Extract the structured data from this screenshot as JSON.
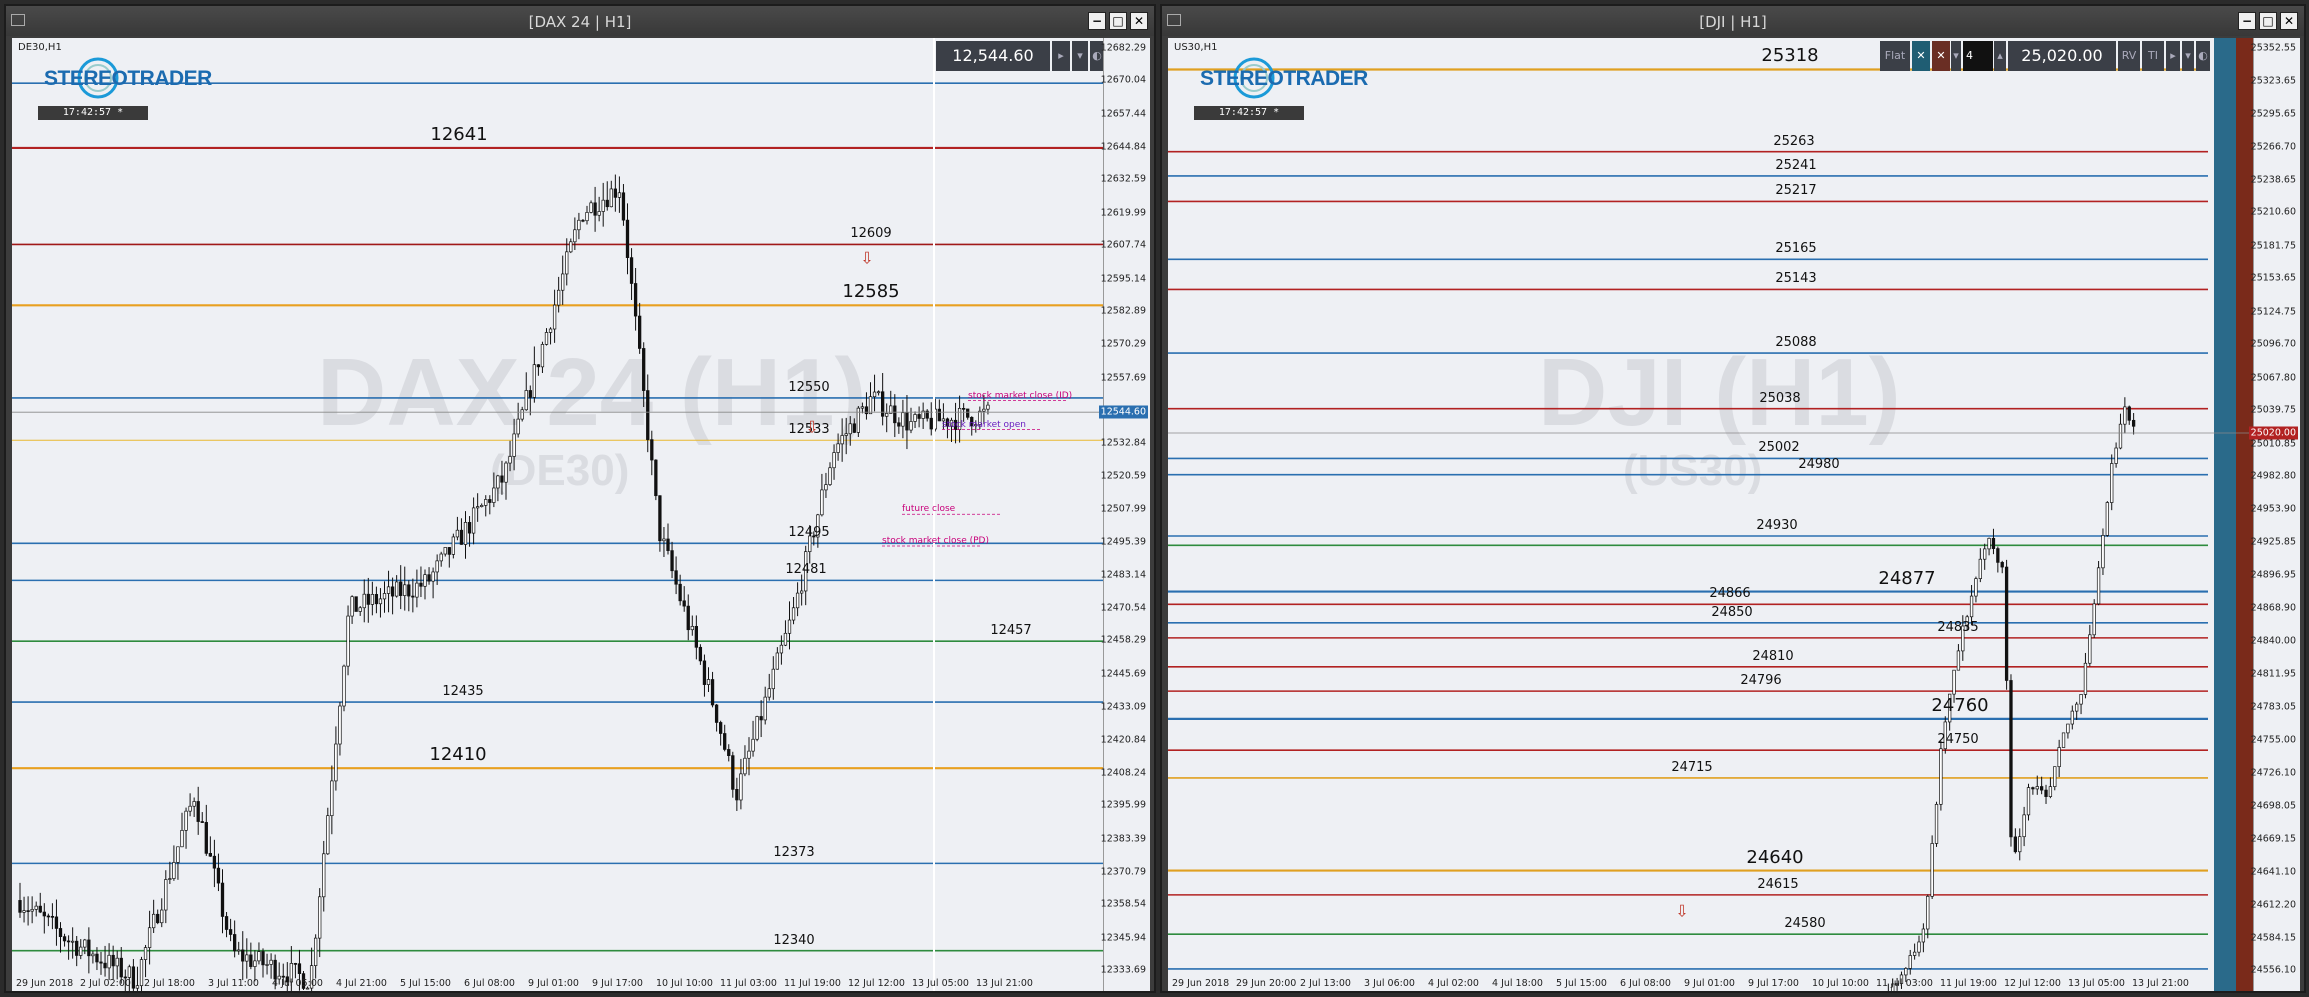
{
  "left": {
    "title": "[DAX 24 | H1]",
    "symbol": "DE30,H1",
    "logo": "STEREOTRADER",
    "clock": "17:42:57 *",
    "price_box": "12,544.60",
    "watermark_main": "DAX 24 (H1)",
    "watermark_sub": "(DE30)",
    "current_price": "12544.60",
    "y_ticks": [
      "12682.29",
      "12670.04",
      "12657.44",
      "12644.84",
      "12632.59",
      "12619.99",
      "12607.74",
      "12595.14",
      "12582.89",
      "12570.29",
      "12557.69",
      "12545.44",
      "12532.84",
      "12520.59",
      "12507.99",
      "12495.39",
      "12483.14",
      "12470.54",
      "12458.29",
      "12445.69",
      "12433.09",
      "12420.84",
      "12408.24",
      "12395.99",
      "12383.39",
      "12370.79",
      "12358.54",
      "12345.94",
      "12333.69"
    ],
    "x_ticks": [
      "29 Jun 2018",
      "2 Jul 02:00",
      "2 Jul 18:00",
      "3 Jul 11:00",
      "4 Jul 05:00",
      "4 Jul 21:00",
      "5 Jul 15:00",
      "6 Jul 08:00",
      "9 Jul 01:00",
      "9 Jul 17:00",
      "10 Jul 10:00",
      "11 Jul 03:00",
      "11 Jul 19:00",
      "12 Jul 12:00",
      "13 Jul 05:00",
      "13 Jul 21:00"
    ],
    "levels": [
      {
        "label": "12641",
        "price": 12644.5,
        "color": "#b22222",
        "big": true
      },
      {
        "label": "12609",
        "price": 12608,
        "color": "#a01818",
        "big": false
      },
      {
        "label": "12585",
        "price": 12585,
        "color": "#e8a020",
        "big": true
      },
      {
        "label": "12550",
        "price": 12550,
        "color": "#2a6fb0",
        "big": false
      },
      {
        "label": "12533",
        "price": 12534,
        "color": "#e8b830",
        "big": false
      },
      {
        "label": "12495",
        "price": 12495,
        "color": "#2a6fb0",
        "big": false
      },
      {
        "label": "12481",
        "price": 12481,
        "color": "#2a6fb0",
        "big": false
      },
      {
        "label": "12457",
        "price": 12458,
        "color": "#2e8b3e",
        "big": false
      },
      {
        "label": "12435",
        "price": 12435,
        "color": "#2a6fb0",
        "big": false
      },
      {
        "label": "12410",
        "price": 12410,
        "color": "#e8a020",
        "big": true
      },
      {
        "label": "12373",
        "price": 12374,
        "color": "#2a6fb0",
        "big": false
      },
      {
        "label": "12340",
        "price": 12341,
        "color": "#2e8b3e",
        "big": false
      },
      {
        "label": "",
        "price": 12669,
        "color": "#2a6fb0",
        "big": false
      }
    ],
    "annotations": [
      "stock market close (ID)",
      "stock market open",
      "future close",
      "stock market close (PD)"
    ]
  },
  "right": {
    "title": "[DJI | H1]",
    "symbol": "US30,H1",
    "logo": "STEREOTRADER",
    "clock": "17:42:57 *",
    "price_box": "25,020.00",
    "toolbar": {
      "flat": "Flat",
      "lots": "4",
      "rv": "RV",
      "tl": "TI"
    },
    "watermark_main": "DJI (H1)",
    "watermark_sub": "(US30)",
    "current_price": "25020.00",
    "y_ticks": [
      "25352.55",
      "25323.65",
      "25295.65",
      "25266.70",
      "25238.65",
      "25210.60",
      "25181.75",
      "25153.65",
      "25124.75",
      "25096.70",
      "25067.80",
      "25039.75",
      "25010.85",
      "24982.80",
      "24953.90",
      "24925.85",
      "24896.95",
      "24868.90",
      "24840.00",
      "24811.95",
      "24783.05",
      "24755.00",
      "24726.10",
      "24698.05",
      "24669.15",
      "24641.10",
      "24612.20",
      "24584.15",
      "24556.10"
    ],
    "x_ticks": [
      "29 Jun 2018",
      "29 Jun 20:00",
      "2 Jul 13:00",
      "3 Jul 06:00",
      "4 Jul 02:00",
      "4 Jul 18:00",
      "5 Jul 15:00",
      "6 Jul 08:00",
      "9 Jul 01:00",
      "9 Jul 17:00",
      "10 Jul 10:00",
      "11 Jul 03:00",
      "11 Jul 19:00",
      "12 Jul 12:00",
      "13 Jul 05:00",
      "13 Jul 21:00"
    ],
    "levels": [
      {
        "label": "25318",
        "price": 25334,
        "color": "#e0a020",
        "big": true
      },
      {
        "label": "25263",
        "price": 25263,
        "color": "#b22222",
        "big": false
      },
      {
        "label": "25241",
        "price": 25242,
        "color": "#2a6fb0",
        "big": false
      },
      {
        "label": "25217",
        "price": 25220,
        "color": "#b22222",
        "big": false
      },
      {
        "label": "25165",
        "price": 25170,
        "color": "#2a6fb0",
        "big": false
      },
      {
        "label": "25143",
        "price": 25144,
        "color": "#b22222",
        "big": false
      },
      {
        "label": "25088",
        "price": 25089,
        "color": "#2a6fb0",
        "big": false
      },
      {
        "label": "25038",
        "price": 25041,
        "color": "#b22222",
        "big": false
      },
      {
        "label": "25002",
        "price": 24998,
        "color": "#2a6fb0",
        "big": false
      },
      {
        "label": "24980",
        "price": 24984,
        "color": "#2a6fb0",
        "big": false
      },
      {
        "label": "24930",
        "price": 24931,
        "color": "#2a6fb0",
        "big": false
      },
      {
        "label": "",
        "price": 24923,
        "color": "#2e8b3e",
        "big": false
      },
      {
        "label": "24877",
        "price": 24883,
        "color": "#2a6fb0",
        "big": true
      },
      {
        "label": "24866",
        "price": 24872,
        "color": "#b22222",
        "big": false
      },
      {
        "label": "24850",
        "price": 24856,
        "color": "#2a6fb0",
        "big": false
      },
      {
        "label": "24835",
        "price": 24843,
        "color": "#b22222",
        "big": false
      },
      {
        "label": "24810",
        "price": 24818,
        "color": "#b22222",
        "big": false
      },
      {
        "label": "24796",
        "price": 24797,
        "color": "#b22222",
        "big": false
      },
      {
        "label": "24760",
        "price": 24773,
        "color": "#2a6fb0",
        "big": true
      },
      {
        "label": "24750",
        "price": 24746,
        "color": "#b22222",
        "big": false
      },
      {
        "label": "24715",
        "price": 24722,
        "color": "#e0a020",
        "big": false
      },
      {
        "label": "24640",
        "price": 24642,
        "color": "#e0a020",
        "big": true
      },
      {
        "label": "24615",
        "price": 24621,
        "color": "#b22222",
        "big": false
      },
      {
        "label": "24580",
        "price": 24587,
        "color": "#2e8b3e",
        "big": false
      },
      {
        "label": "",
        "price": 24557,
        "color": "#2a6fb0",
        "big": false
      }
    ]
  }
}
